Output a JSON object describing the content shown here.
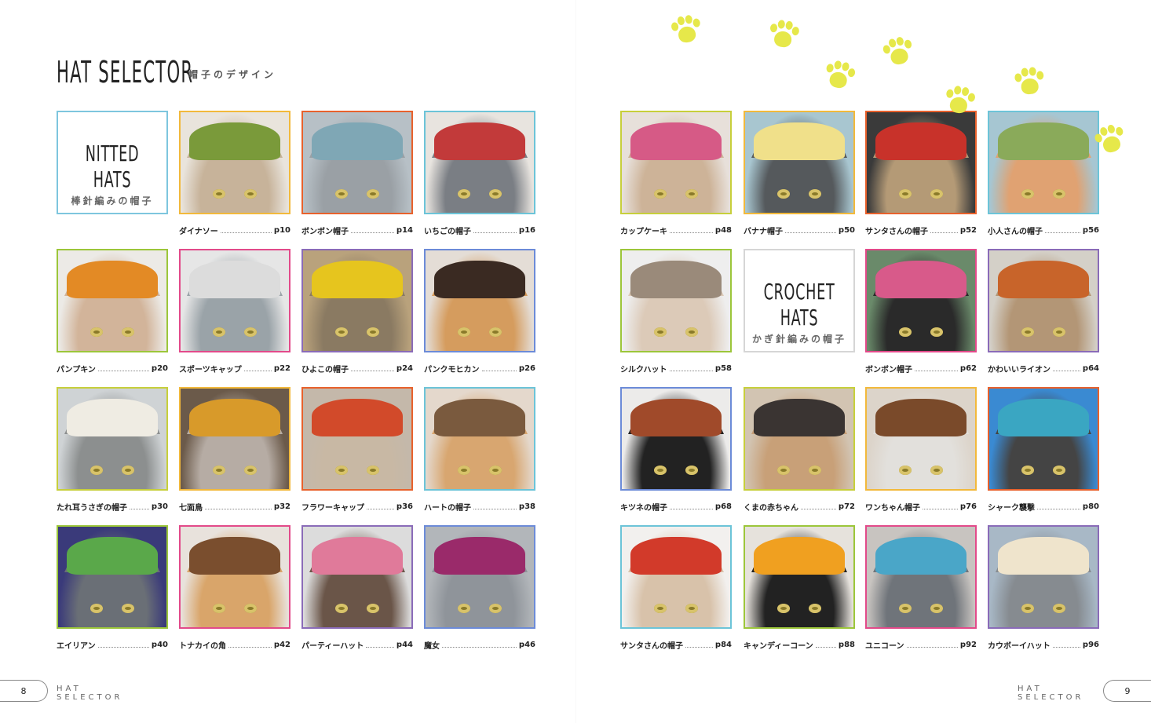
{
  "header": {
    "title": "HAT SELECTOR",
    "subtitle": "帽子のデザイン"
  },
  "sections": {
    "knitted": {
      "en": "NITTED HATS",
      "ja": "棒針編みの帽子"
    },
    "crochet": {
      "en": "CROCHET HATS",
      "ja": "かぎ針編みの帽子"
    }
  },
  "items": [
    {
      "label": "ダイナソー",
      "page": "p10",
      "hat": "#7a9a3a",
      "bg": "#e9e4dc",
      "fur": "#c7b39a"
    },
    {
      "label": "ボンボン帽子",
      "page": "p14",
      "hat": "#7fa7b5",
      "bg": "#b7c0c6",
      "fur": "#9aa0a5"
    },
    {
      "label": "いちごの帽子",
      "page": "p16",
      "hat": "#c23a3a",
      "bg": "#e8e4df",
      "fur": "#7a7e84"
    },
    {
      "label": "パンプキン",
      "page": "p20",
      "hat": "#e38a25",
      "bg": "#eceae6",
      "fur": "#d2b49a"
    },
    {
      "label": "スポーツキャップ",
      "page": "p22",
      "hat": "#dcdcdc",
      "bg": "#e6e6e6",
      "fur": "#9aa3a8"
    },
    {
      "label": "ひよこの帽子",
      "page": "p24",
      "hat": "#e6c51e",
      "bg": "#b9a27c",
      "fur": "#8a7a62"
    },
    {
      "label": "パンクモヒカン",
      "page": "p26",
      "hat": "#3a2a22",
      "bg": "#e4ddd6",
      "fur": "#d59c5e"
    },
    {
      "label": "たれ耳うさぎの帽子",
      "page": "p30",
      "hat": "#efece3",
      "bg": "#cfd3d5",
      "fur": "#8c8f8f"
    },
    {
      "label": "七面鳥",
      "page": "p32",
      "hat": "#d89a2a",
      "bg": "#6b5a4a",
      "fur": "#b6aca4"
    },
    {
      "label": "フラワーキャップ",
      "page": "p36",
      "hat": "#d24a2a",
      "bg": "#c4b8aa",
      "fur": "#c8b8a4"
    },
    {
      "label": "ハートの帽子",
      "page": "p38",
      "hat": "#7a5a3e",
      "bg": "#e4d8cc",
      "fur": "#d8a670"
    },
    {
      "label": "エイリアン",
      "page": "p40",
      "hat": "#5aa84a",
      "bg": "#3a3a7a",
      "fur": "#6a6f76"
    },
    {
      "label": "トナカイの角",
      "page": "p42",
      "hat": "#7a4e2e",
      "bg": "#e8e2dc",
      "fur": "#d9a56a"
    },
    {
      "label": "パーティーハット",
      "page": "p44",
      "hat": "#e07a9a",
      "bg": "#dcdcdc",
      "fur": "#6a5548"
    },
    {
      "label": "魔女",
      "page": "p46",
      "hat": "#9a2a6a",
      "bg": "#b2b6ba",
      "fur": "#8f949a"
    },
    {
      "label": "カップケーキ",
      "page": "p48",
      "hat": "#d65a86",
      "bg": "#e7e0da",
      "fur": "#cdb398"
    },
    {
      "label": "バナナ帽子",
      "page": "p50",
      "hat": "#f0e08a",
      "bg": "#a8c6d0",
      "fur": "#55595c"
    },
    {
      "label": "サンタさんの帽子",
      "page": "p52",
      "hat": "#c8322a",
      "bg": "#3a3a3a",
      "fur": "#b49a76"
    },
    {
      "label": "小人さんの帽子",
      "page": "p56",
      "hat": "#8aaa5a",
      "bg": "#a6c6d2",
      "fur": "#e0a272"
    },
    {
      "label": "シルクハット",
      "page": "p58",
      "hat": "#9a8a7a",
      "bg": "#eeeeee",
      "fur": "#dccab8"
    },
    {
      "label": "ボンボン帽子",
      "page": "p62",
      "hat": "#d85a8a",
      "bg": "#6a8a6a",
      "fur": "#2a2a2a"
    },
    {
      "label": "かわいいライオン",
      "page": "p64",
      "hat": "#c8642a",
      "bg": "#d4d0c8",
      "fur": "#b39676"
    },
    {
      "label": "キツネの帽子",
      "page": "p68",
      "hat": "#a04a2a",
      "bg": "#ecebea",
      "fur": "#222222"
    },
    {
      "label": "くまの赤ちゃん",
      "page": "p72",
      "hat": "#3a3432",
      "bg": "#d2c4b2",
      "fur": "#c8a078"
    },
    {
      "label": "ワンちゃん帽子",
      "page": "p76",
      "hat": "#7a4a2a",
      "bg": "#dcd4ca",
      "fur": "#e2e0dc"
    },
    {
      "label": "シャーク襲撃",
      "page": "p80",
      "hat": "#3aa6c2",
      "bg": "#3a8ad2",
      "fur": "#444444"
    },
    {
      "label": "サンタさんの帽子",
      "page": "p84",
      "hat": "#d23a2a",
      "bg": "#f2f0ee",
      "fur": "#d8c2aa"
    },
    {
      "label": "キャンディーコーン",
      "page": "p88",
      "hat": "#f0a020",
      "bg": "#e6e2dc",
      "fur": "#222222"
    },
    {
      "label": "ユニコーン",
      "page": "p92",
      "hat": "#4aa6c8",
      "bg": "#c8c4c0",
      "fur": "#6f747a"
    },
    {
      "label": "カウボーイハット",
      "page": "p96",
      "hat": "#efe4cc",
      "bg": "#a8b8c6",
      "fur": "#868b90"
    }
  ],
  "footer": {
    "left": {
      "page": "8",
      "text": "HAT SELECTOR"
    },
    "right": {
      "page": "9",
      "text": "HAT SELECTOR"
    }
  },
  "frame_colors": [
    "#f2b93b",
    "#e8612c",
    "#6cc4d8",
    "#9cc63a",
    "#e24a8a",
    "#8a6bb8",
    "#6c8bd8",
    "#c7cf3b"
  ]
}
